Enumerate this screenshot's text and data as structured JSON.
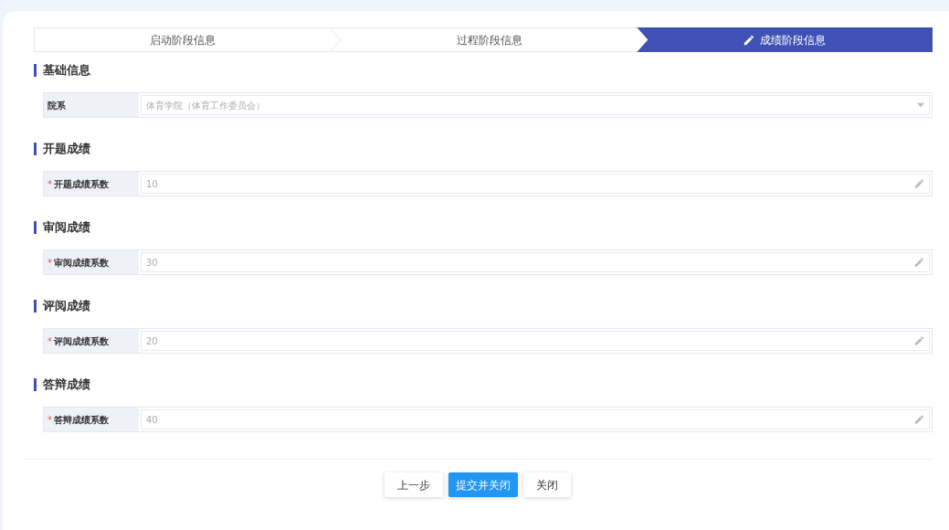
{
  "steps": [
    {
      "label": "启动阶段信息",
      "selected": false
    },
    {
      "label": "过程阶段信息",
      "selected": false
    },
    {
      "label": "成绩阶段信息",
      "selected": true
    }
  ],
  "sections": [
    {
      "title": "基础信息",
      "fields": [
        {
          "label": "院系",
          "kind": "select",
          "value": "体育学院（体育工作委员会）"
        }
      ]
    },
    {
      "title": "开题成绩",
      "fields": [
        {
          "label": "开题成绩系数",
          "mark": "*",
          "kind": "text",
          "value": "10"
        }
      ]
    },
    {
      "title": "审阅成绩",
      "fields": [
        {
          "label": "审阅成绩系数",
          "mark": "*",
          "kind": "text",
          "value": "30"
        }
      ]
    },
    {
      "title": "评阅成绩",
      "fields": [
        {
          "label": "评阅成绩系数",
          "mark": "*",
          "kind": "text",
          "value": "20"
        }
      ]
    },
    {
      "title": "答辩成绩",
      "fields": [
        {
          "label": "答辩成绩系数",
          "mark": "*",
          "kind": "text",
          "value": "40"
        }
      ]
    }
  ],
  "buttons": [
    {
      "label": "上一步",
      "kind": "default"
    },
    {
      "label": "提交并关闭",
      "kind": "primary"
    },
    {
      "label": "关闭",
      "kind": "default"
    }
  ]
}
